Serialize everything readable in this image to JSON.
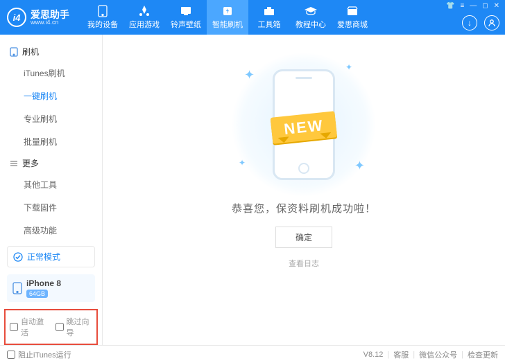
{
  "header": {
    "brand_name": "爱思助手",
    "brand_site": "www.i4.cn",
    "nav": [
      {
        "label": "我的设备"
      },
      {
        "label": "应用游戏"
      },
      {
        "label": "铃声壁纸"
      },
      {
        "label": "智能刷机"
      },
      {
        "label": "工具箱"
      },
      {
        "label": "教程中心"
      },
      {
        "label": "爱思商城"
      }
    ]
  },
  "sidebar": {
    "group1": "刷机",
    "items1": [
      {
        "label": "iTunes刷机"
      },
      {
        "label": "一键刷机"
      },
      {
        "label": "专业刷机"
      },
      {
        "label": "批量刷机"
      }
    ],
    "group2": "更多",
    "items2": [
      {
        "label": "其他工具"
      },
      {
        "label": "下载固件"
      },
      {
        "label": "高级功能"
      }
    ],
    "status": "正常模式",
    "device": "iPhone 8",
    "capacity": "64GB",
    "checks": {
      "auto_activate": "自动激活",
      "skip_guide": "跳过向导"
    }
  },
  "main": {
    "ribbon": "NEW",
    "message": "恭喜您，保资料刷机成功啦！",
    "ok": "确定",
    "log": "查看日志"
  },
  "footer": {
    "block_itunes": "阻止iTunes运行",
    "version": "V8.12",
    "kefu": "客服",
    "wechat": "微信公众号",
    "update": "检查更新"
  }
}
